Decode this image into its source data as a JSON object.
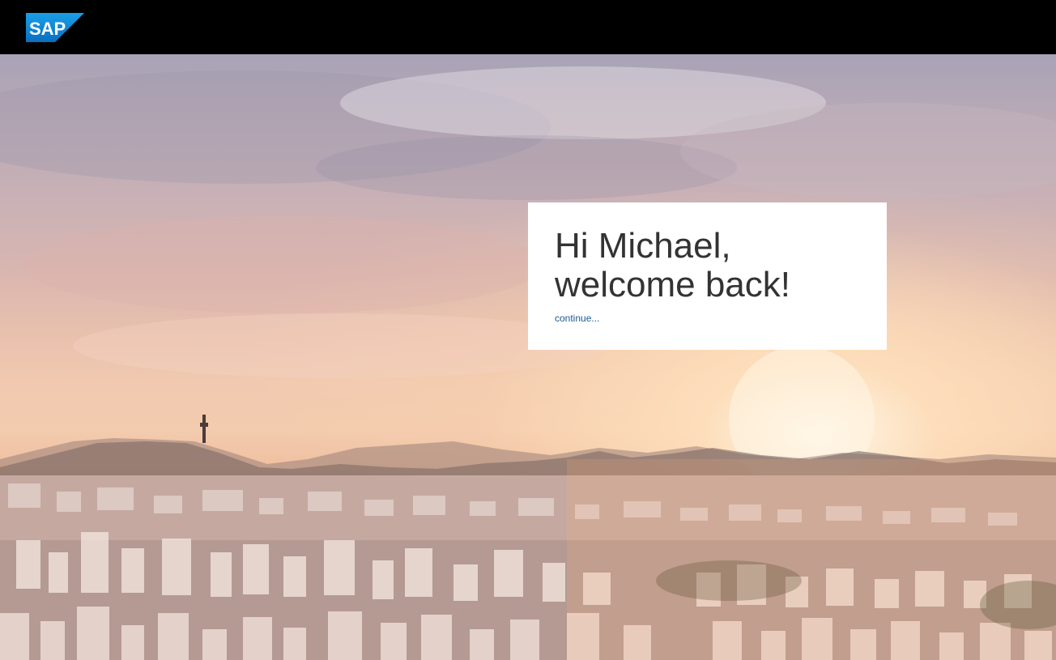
{
  "header": {
    "logo_text": "SAP",
    "logo_color": "#0a79c8",
    "background": "#000000"
  },
  "welcome": {
    "line1": "Hi Michael,",
    "line2": "welcome back!",
    "continue_label": "continue..."
  },
  "colors": {
    "card_background": "#ffffff",
    "text": "#333333",
    "link": "#1a5a96"
  }
}
